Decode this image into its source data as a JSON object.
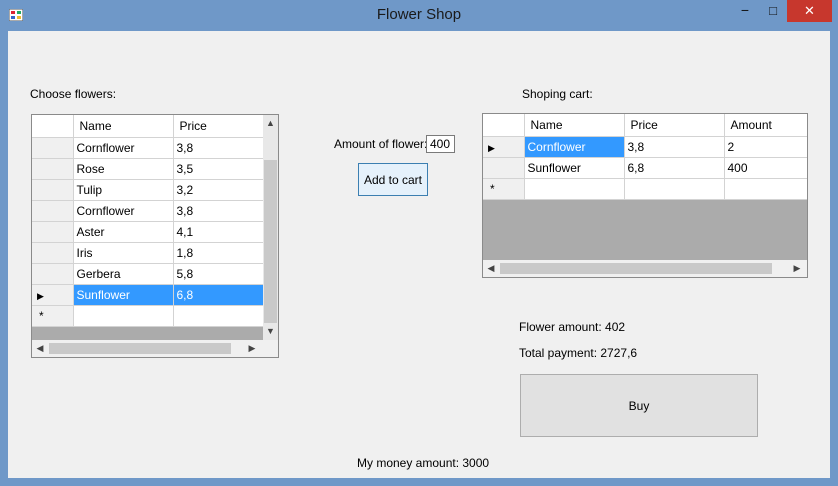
{
  "window": {
    "title": "Flower Shop",
    "minimize": "−",
    "maximize": "□",
    "close": "✕"
  },
  "choose": {
    "label": "Choose flowers:",
    "columns": [
      "Name",
      "Price"
    ],
    "rows": [
      {
        "name": "Cornflower",
        "price": "3,8"
      },
      {
        "name": "Rose",
        "price": "3,5"
      },
      {
        "name": "Tulip",
        "price": "3,2"
      },
      {
        "name": "Cornflower",
        "price": "3,8"
      },
      {
        "name": "Aster",
        "price": "4,1"
      },
      {
        "name": "Iris",
        "price": "1,8"
      },
      {
        "name": "Gerbera",
        "price": "5,8"
      },
      {
        "name": "Sunflower",
        "price": "6,8"
      }
    ],
    "selected_row": "Sunflower",
    "new_row_marker": "*"
  },
  "amount": {
    "label": "Amount of flower:",
    "value": "400"
  },
  "add_button": "Add to cart",
  "cart": {
    "label": "Shoping cart:",
    "columns": [
      "Name",
      "Price",
      "Amount"
    ],
    "rows": [
      {
        "name": "Cornflower",
        "price": "3,8",
        "amount": "2"
      },
      {
        "name": "Sunflower",
        "price": "6,8",
        "amount": "400"
      }
    ],
    "new_row_marker": "*"
  },
  "summary": {
    "flower_amount": "Flower amount: 402",
    "total_payment": "Total payment: 2727,6"
  },
  "buy_button": "Buy",
  "money": "My money amount: 3000",
  "icons": {
    "row-pointer": "▶",
    "up": "▲",
    "down": "▼",
    "left": "◀",
    "right": "▶"
  },
  "colors": {
    "selection": "#3399ff",
    "titlebar": "#6f98c8",
    "close": "#c7372d"
  }
}
